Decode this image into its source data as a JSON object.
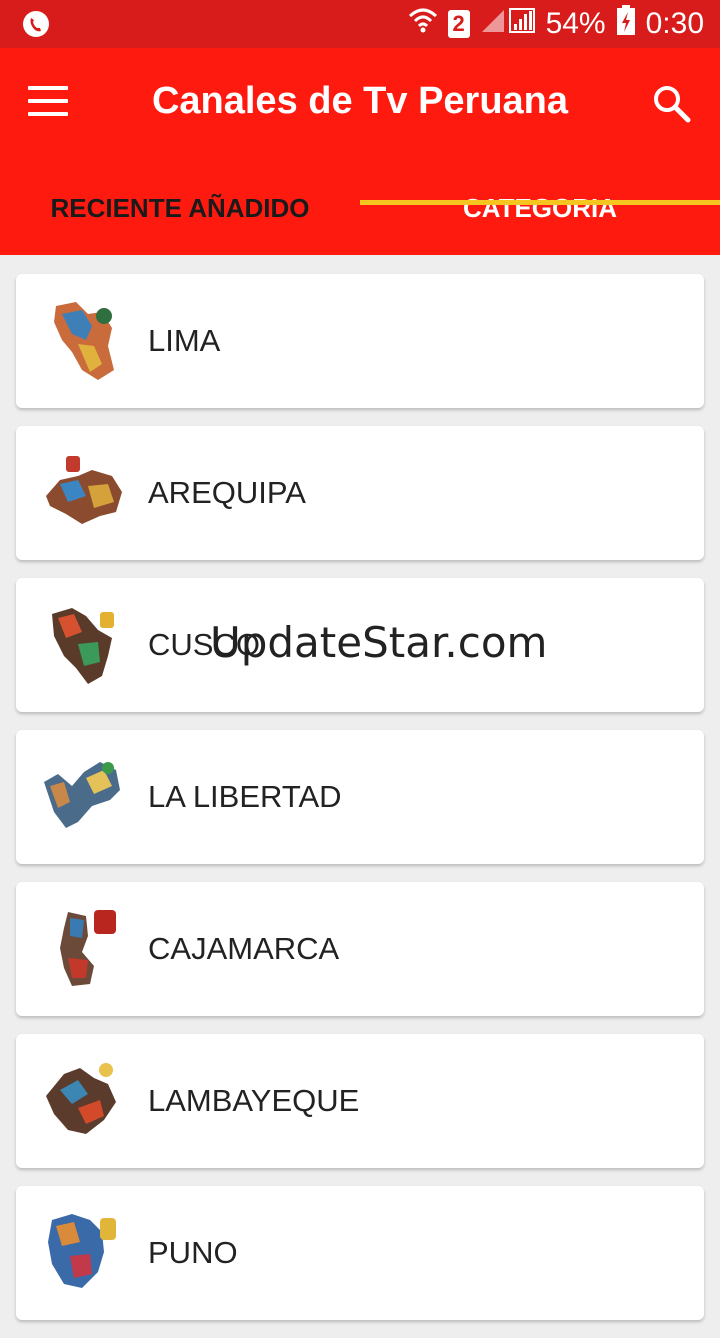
{
  "status_bar": {
    "sim_slot": "2",
    "battery": "54%",
    "time": "0:30",
    "icons": [
      "phone-call-icon",
      "wifi-icon",
      "signal-icon",
      "battery-charging-icon"
    ]
  },
  "app_bar": {
    "title": "Canales de Tv Peruana",
    "menu_icon": "hamburger-menu-icon",
    "search_icon": "search-icon",
    "color": "#ff1a10"
  },
  "tabs": [
    {
      "label": "RECIENTE AÑADIDO",
      "selected": false
    },
    {
      "label": "CATEGORIA",
      "selected": true
    }
  ],
  "tab_indicator_color": "#f7c520",
  "categories": [
    {
      "label": "LIMA"
    },
    {
      "label": "AREQUIPA"
    },
    {
      "label": "CUSCO"
    },
    {
      "label": "LA LIBERTAD"
    },
    {
      "label": "CAJAMARCA"
    },
    {
      "label": "LAMBAYEQUE"
    },
    {
      "label": "PUNO"
    }
  ],
  "watermark": "UpdateStar.com"
}
